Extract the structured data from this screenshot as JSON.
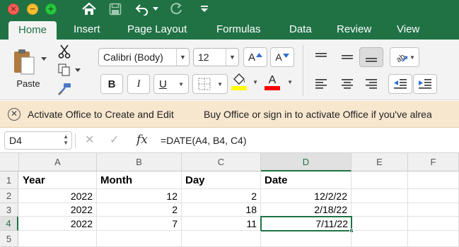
{
  "window": {
    "colors": {
      "accent": "#207245",
      "message_bar": "#f8e7cf"
    }
  },
  "quick_access": {
    "icons": [
      "home-icon",
      "save-icon",
      "undo-icon",
      "redo-icon",
      "customize-icon"
    ]
  },
  "tabs": [
    "Home",
    "Insert",
    "Page Layout",
    "Formulas",
    "Data",
    "Review",
    "View"
  ],
  "active_tab": "Home",
  "ribbon": {
    "paste_label": "Paste",
    "font_name": "Calibri (Body)",
    "font_size": "12",
    "increase_font_label": "A",
    "decrease_font_label": "A",
    "bold_label": "B",
    "italic_label": "I",
    "underline_label": "U",
    "highlight_color": "#ffff00",
    "font_color": "#ff0000"
  },
  "message_bar": {
    "title": "Activate Office to Create and Edit",
    "text": "Buy Office or sign in to activate Office if you've alrea"
  },
  "formula_bar": {
    "name_box": "D4",
    "cancel_label": "✕",
    "enter_label": "✓",
    "fx_label": "fx",
    "formula": "=DATE(A4, B4, C4)"
  },
  "sheet": {
    "columns": [
      "A",
      "B",
      "C",
      "D",
      "E",
      "F"
    ],
    "selected_column": "D",
    "rows": [
      "1",
      "2",
      "3",
      "4",
      "5"
    ],
    "selected_row": "4",
    "headers": [
      "Year",
      "Month",
      "Day",
      "Date"
    ],
    "data": [
      [
        "2022",
        "12",
        "2",
        "12/2/22"
      ],
      [
        "2022",
        "2",
        "18",
        "2/18/22"
      ],
      [
        "2022",
        "7",
        "11",
        "7/11/22"
      ]
    ]
  }
}
